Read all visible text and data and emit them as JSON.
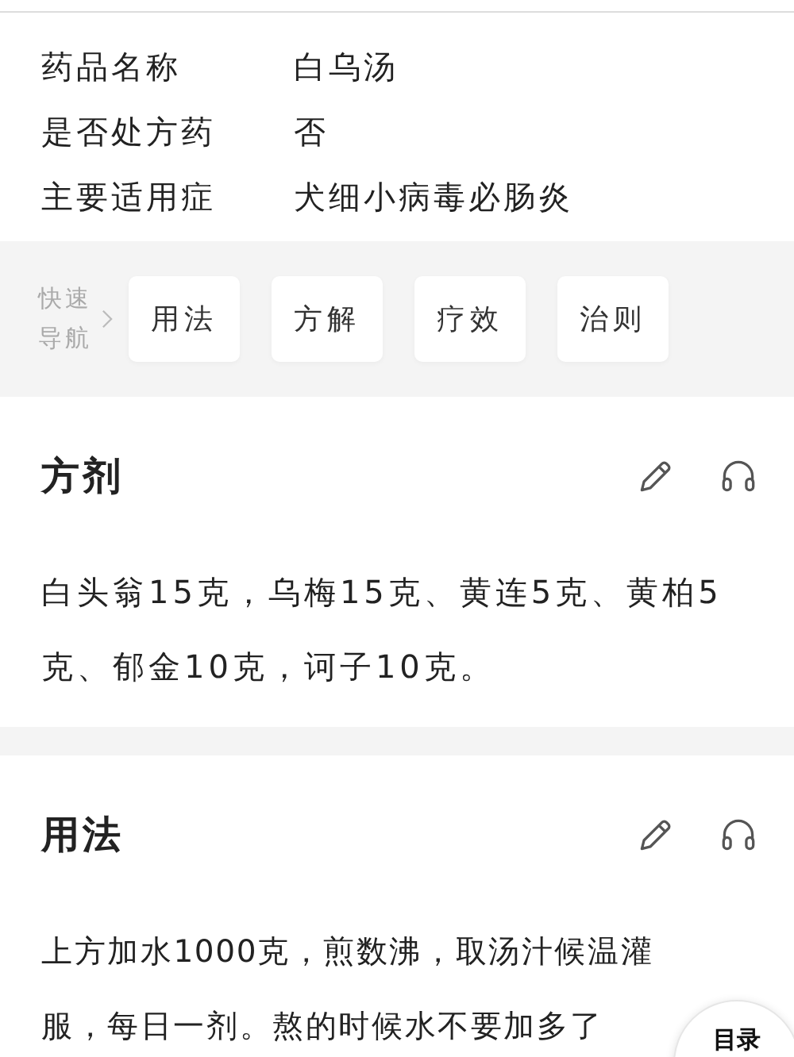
{
  "info": [
    {
      "label": "药品名称",
      "value": "白乌汤"
    },
    {
      "label": "是否处方药",
      "value": "否"
    },
    {
      "label": "主要适用症",
      "value": "犬细小病毒必肠炎"
    }
  ],
  "quick_nav": {
    "label_lines": [
      "快速",
      "导航"
    ],
    "items": [
      "用法",
      "方解",
      "疗效",
      "治则"
    ]
  },
  "sections": [
    {
      "title": "方剂",
      "body": "白头翁15克，乌梅15克、黄连5克、黄柏5克、郁金10克，诃子10克。"
    },
    {
      "title": "用法",
      "body": "上方加水1000克，煎数沸，取汤汁候温灌服，每日一剂。熬的时候水不要加多了"
    }
  ],
  "toc_button": "目录"
}
